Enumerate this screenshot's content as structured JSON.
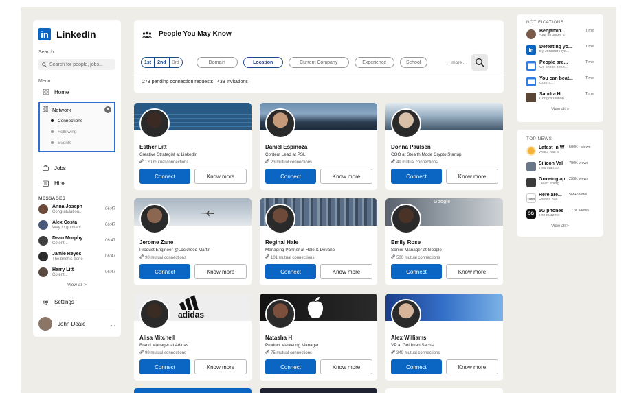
{
  "brand": {
    "name": "LinkedIn",
    "logo": "in"
  },
  "sidebar": {
    "search_label": "Search",
    "search_placeholder": "Search for people, jobs...",
    "menu_label": "Menu",
    "home": "Home",
    "network": "Network",
    "network_sub": [
      "Connections",
      "Following",
      "Events"
    ],
    "jobs": "Jobs",
    "hire": "Hire",
    "messages_label": "MESSAGES",
    "messages": [
      {
        "name": "Anna Joseph",
        "preview": "Congratulation...",
        "time": "06:47"
      },
      {
        "name": "Alex Costa",
        "preview": "Way to go man!",
        "time": "06:47"
      },
      {
        "name": "Dean Murphy",
        "preview": "Cotent...",
        "time": "06:47"
      },
      {
        "name": "Jamie Reyes",
        "preview": "The brief is done",
        "time": "06:47"
      },
      {
        "name": "Harry Litt",
        "preview": "Cotent...",
        "time": "06:47"
      }
    ],
    "view_all": "View all >",
    "settings": "Settings",
    "user_name": "John Deale",
    "user_more": "..."
  },
  "header": {
    "title": "People You May Know",
    "degrees": [
      "1st",
      "2nd",
      "3rd"
    ],
    "filters": [
      "Domain",
      "Location",
      "Current Company",
      "Experience",
      "School"
    ],
    "selected_filter": "Location",
    "more": "+ more ..",
    "pending": "273 pending connection requests",
    "invitations": "433 invitations"
  },
  "people": [
    {
      "name": "Esther Litt",
      "role": "Creative Strategist at LinkedIn",
      "mutual": "120 mutual connections"
    },
    {
      "name": "Daniel Espinoza",
      "role": "Content Lead at PSL",
      "mutual": "23 mutual connections"
    },
    {
      "name": "Donna Paulsen",
      "role": "COO at Stealth Mode Crypto Startup",
      "mutual": "49 mutual connections"
    },
    {
      "name": "Jerome Zane",
      "role": "Product Engineer @Lockheed Martin",
      "mutual": "90 mutual connections"
    },
    {
      "name": "Reginal Hale",
      "role": "Managing Partner at Hale & Devane",
      "mutual": "101 mutual connections"
    },
    {
      "name": "Emily Rose",
      "role": "Senior Manager at Google",
      "mutual": "500 mutual connections"
    },
    {
      "name": "Alisa Mitchell",
      "role": "Brand Manager at Adidas",
      "mutual": "99 mutual connections"
    },
    {
      "name": "Natasha H",
      "role": "Product Marketing Manager",
      "mutual": "75 mutual connections"
    },
    {
      "name": "Alex Williams",
      "role": "VP at Goldman Sachs",
      "mutual": "349 mutual connections"
    }
  ],
  "card_buttons": {
    "connect": "Connect",
    "know_more": "Know more"
  },
  "cover_texts": {
    "adidas": "adidas",
    "google": "Google"
  },
  "notifications": {
    "title": "NOTIFICATIONS",
    "items": [
      {
        "title": "Benjamin...",
        "sub": "See all views >",
        "time": "Time"
      },
      {
        "title": "Defeating yo...",
        "sub": "By Jennifer Rya...",
        "time": "Time"
      },
      {
        "title": "People are...",
        "sub": "Go check it out...",
        "time": "Time"
      },
      {
        "title": "You can beat...",
        "sub": "Cotent...",
        "time": "Time"
      },
      {
        "title": "Sandra H.",
        "sub": "Congratulation...",
        "time": "Time"
      }
    ],
    "view_all": "View all >"
  },
  "top_news": {
    "title": "TOP NEWS",
    "items": [
      {
        "title": "Latest in W",
        "sub": "Web3 has s",
        "views": "500K+ views"
      },
      {
        "title": "Silicon Val",
        "sub": "This startup",
        "views": "700K views"
      },
      {
        "title": "Growing ap",
        "sub": "Clean energ",
        "views": "235K views"
      },
      {
        "title": "Here are...",
        "sub": "Forbes has...",
        "views": "5M+ views",
        "icon_text": "Forbes"
      },
      {
        "title": "5G phones",
        "sub": "The buzz for",
        "views": "177K Views",
        "icon_text": "5G"
      }
    ],
    "view_all": "View all >"
  }
}
